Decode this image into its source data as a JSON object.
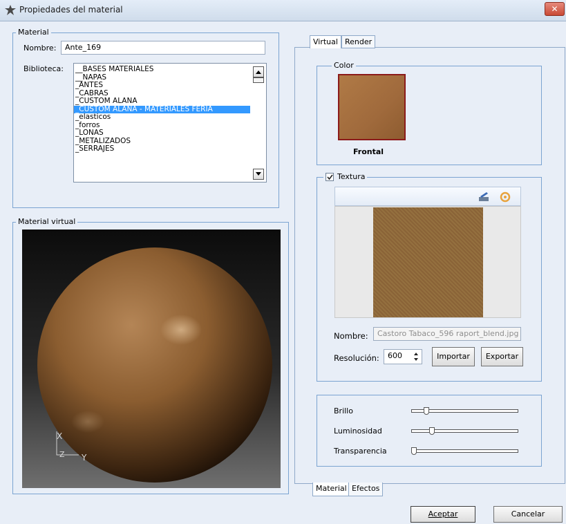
{
  "window": {
    "title": "Propiedades del material",
    "close": "✕"
  },
  "material": {
    "group_label": "Material",
    "name_label": "Nombre:",
    "name_value": "Ante_169",
    "library_label": "Biblioteca:",
    "library_items": [
      "__BASES MATERIALES",
      "__NAPAS",
      "_ANTES",
      "_CABRAS",
      "_CUSTOM ALANA",
      "_CUSTOM ALANA - MATERIALES FERIA",
      "_elasticos",
      "_forros",
      "_LONAS",
      "_METALIZADOS",
      "_SERRAJES"
    ],
    "selected_index": 5
  },
  "preview": {
    "group_label": "Material virtual",
    "axis_x": "X",
    "axis_z": "Z",
    "axis_y": "Y"
  },
  "top_tabs": [
    "Virtual",
    "Render"
  ],
  "color": {
    "group_label": "Color",
    "swatch": "#a06a3c",
    "caption": "Frontal"
  },
  "texture": {
    "group_label": "Textura",
    "checked": true,
    "name_label": "Nombre:",
    "name_value": "Castoro Tabaco_596 raport_blend.jpg",
    "resolution_label": "Resolución:",
    "resolution_value": "600",
    "import_label": "Importar",
    "export_label": "Exportar"
  },
  "sliders": [
    {
      "label": "Brillo",
      "value": 0.12
    },
    {
      "label": "Luminosidad",
      "value": 0.18
    },
    {
      "label": "Transparencia",
      "value": 0.0
    }
  ],
  "bottom_tabs": [
    "Material",
    "Efectos"
  ],
  "buttons": {
    "accept": "Aceptar",
    "cancel": "Cancelar"
  },
  "colors": {
    "selection": "#3399ff",
    "frame": "#7aa3d1",
    "swatch_border": "#8b1a1a"
  }
}
